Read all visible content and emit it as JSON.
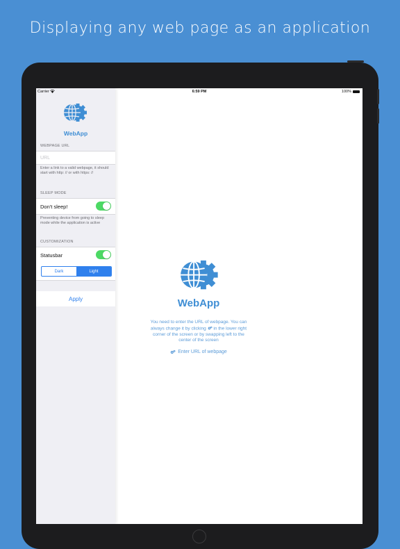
{
  "headline": "Displaying any web page as an application",
  "status_bar": {
    "carrier": "Carrier",
    "time": "6:59 PM",
    "battery": "100%"
  },
  "sidebar": {
    "logo_text": "WebApp",
    "webpage_url": {
      "header": "WEBPAGE URL",
      "placeholder": "URL",
      "value": "",
      "note": "Enter a link to a valid webpage, it should start with http: // or with https: //"
    },
    "sleep_mode": {
      "header": "SLEEP MODE",
      "label": "Don't sleep!",
      "enabled": true,
      "note": "Preventing device from going to sleep mode while the application is active"
    },
    "customization": {
      "header": "CUSTOMIZATION",
      "label": "Statusbar",
      "enabled": true,
      "segments": [
        "Dark",
        "Light"
      ],
      "selected": "Light"
    },
    "apply_label": "Apply"
  },
  "main": {
    "logo_text": "WebApp",
    "message_part1": "You need to enter the URL of webpage. You can always change it by clicking",
    "message_part2": "in the lower right corner of the screen or by swapping left to the center of the screen",
    "enter_url_label": "Enter URL of webpage"
  },
  "colors": {
    "background": "#4a8fd3",
    "accent": "#2f80ed",
    "logo_blue": "#3f8ed4",
    "toggle_on": "#4cd964",
    "text_blue": "#5b9bd8"
  }
}
